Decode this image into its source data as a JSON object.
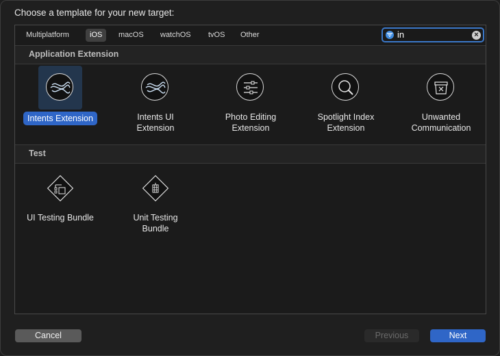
{
  "prompt": "Choose a template for your new target:",
  "platform_tabs": [
    {
      "label": "Multiplatform"
    },
    {
      "label": "iOS",
      "selected": true
    },
    {
      "label": "macOS"
    },
    {
      "label": "watchOS"
    },
    {
      "label": "tvOS"
    },
    {
      "label": "Other"
    }
  ],
  "search": {
    "value": "in",
    "filter_icon": "filter-icon",
    "clear_icon": "clear-icon"
  },
  "sections": [
    {
      "title": "Application Extension",
      "templates": [
        {
          "label": "Intents Extension",
          "icon": "intents-icon",
          "selected": true
        },
        {
          "label": "Intents UI Extension",
          "icon": "intents-ui-icon"
        },
        {
          "label": "Photo Editing Extension",
          "icon": "sliders-icon"
        },
        {
          "label": "Spotlight Index Extension",
          "icon": "magnifier-icon"
        },
        {
          "label": "Unwanted Communication",
          "icon": "blocked-tray-icon"
        }
      ]
    },
    {
      "title": "Test",
      "templates": [
        {
          "label": "UI Testing Bundle",
          "icon": "ui-testing-icon"
        },
        {
          "label": "Unit Testing Bundle",
          "icon": "unit-testing-icon"
        }
      ]
    }
  ],
  "buttons": {
    "cancel": "Cancel",
    "previous": "Previous",
    "next": "Next"
  },
  "colors": {
    "accent": "#2f66c7",
    "search_border": "#3b78c9",
    "selected_tile_bg": "#23364d"
  }
}
